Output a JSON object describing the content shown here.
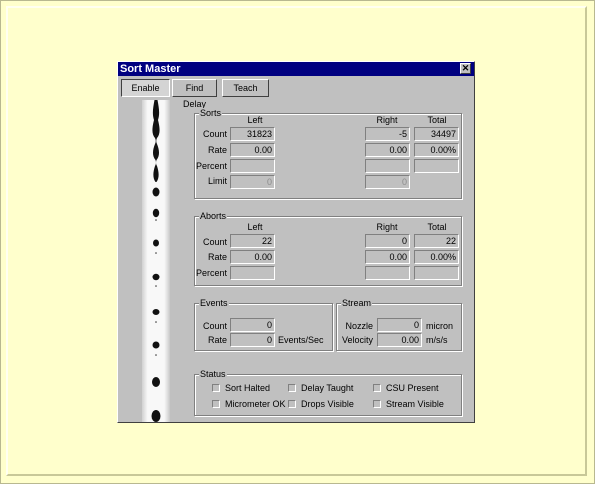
{
  "window": {
    "title": "Sort Master"
  },
  "toolbar": {
    "enable": "Enable",
    "find_delay": "Find Delay",
    "teach": "Teach"
  },
  "sorts": {
    "title": "Sorts",
    "col_left": "Left",
    "col_right": "Right",
    "col_total": "Total",
    "row_count": "Count",
    "row_rate": "Rate",
    "row_percent": "Percent",
    "row_limit": "Limit",
    "count_left": "31823",
    "count_right": "-5",
    "count_total": "34497",
    "rate_left": "0.00",
    "rate_right": "0.00",
    "rate_total": "0.00%",
    "limit_left": "0",
    "limit_right": "0"
  },
  "aborts": {
    "title": "Aborts",
    "col_left": "Left",
    "col_right": "Right",
    "col_total": "Total",
    "row_count": "Count",
    "row_rate": "Rate",
    "row_percent": "Percent",
    "count_left": "22",
    "count_right": "0",
    "count_total": "22",
    "rate_left": "0.00",
    "rate_right": "0.00",
    "rate_total": "0.00%"
  },
  "events": {
    "title": "Events",
    "row_count": "Count",
    "row_rate": "Rate",
    "count": "0",
    "rate": "0",
    "rate_unit": "Events/Sec"
  },
  "stream": {
    "title": "Stream",
    "row_nozzle": "Nozzle",
    "row_velocity": "Velocity",
    "nozzle": "0",
    "nozzle_unit": "micron",
    "velocity": "0.00",
    "velocity_unit": "m/s/s"
  },
  "status": {
    "title": "Status",
    "sort_halted": "Sort Halted",
    "delay_taught": "Delay Taught",
    "csu_present": "CSU Present",
    "micrometer_ok": "Micrometer OK",
    "drops_visible": "Drops Visible",
    "stream_visible": "Stream Visible"
  }
}
